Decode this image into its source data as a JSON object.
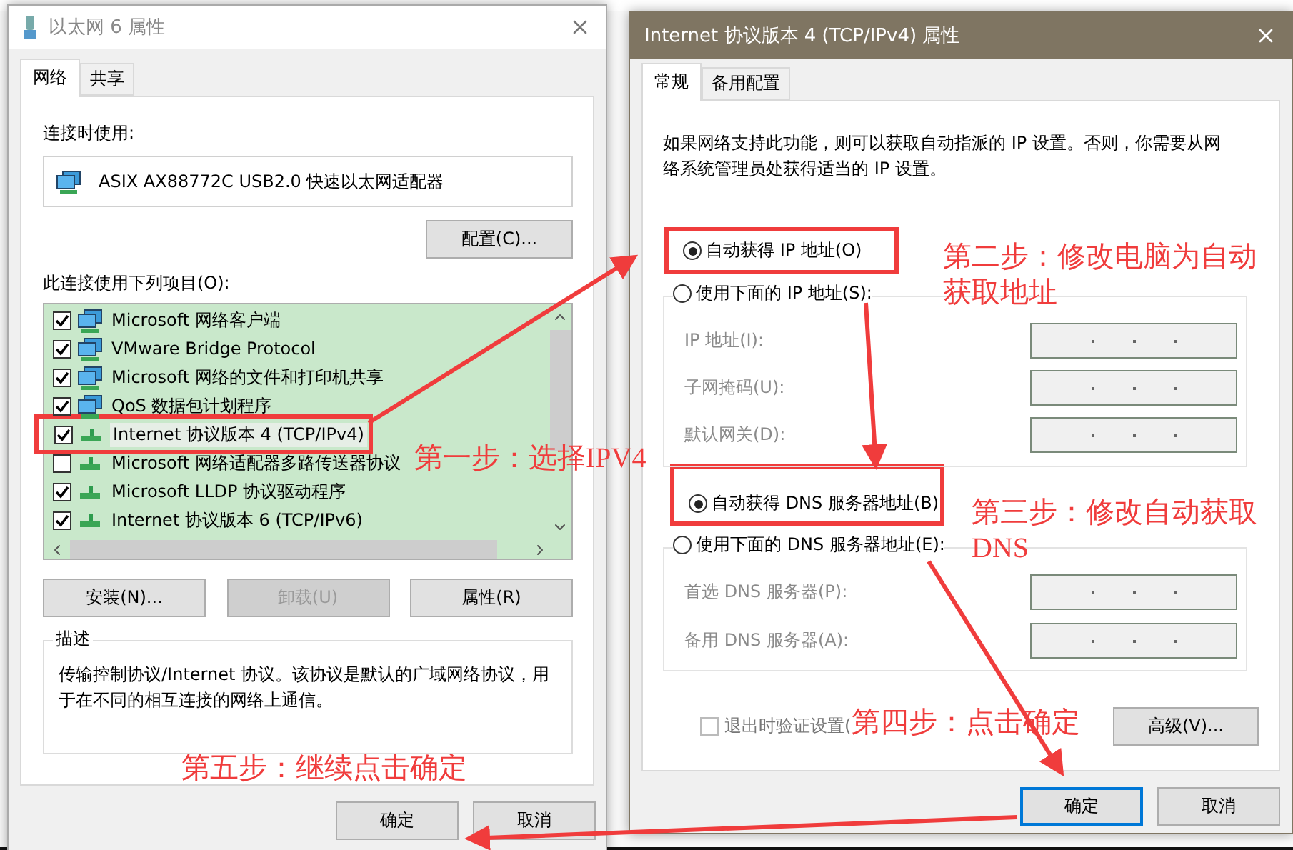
{
  "left_window": {
    "title": "以太网 6 属性",
    "tabs": [
      {
        "label": "网络",
        "selected": true
      },
      {
        "label": "共享",
        "selected": false
      }
    ],
    "connect_using_label": "连接时使用:",
    "adapter": "ASIX AX88772C USB2.0 快速以太网适配器",
    "configure_button": "配置(C)...",
    "items_label": "此连接使用下列项目(O):",
    "items": [
      {
        "label": "Microsoft 网络客户端",
        "checked": true,
        "selected": false,
        "highlighted": false,
        "kind": "client"
      },
      {
        "label": "VMware Bridge Protocol",
        "checked": true,
        "selected": false,
        "highlighted": false,
        "kind": "client"
      },
      {
        "label": "Microsoft 网络的文件和打印机共享",
        "checked": true,
        "selected": false,
        "highlighted": false,
        "kind": "client"
      },
      {
        "label": "QoS 数据包计划程序",
        "checked": true,
        "selected": false,
        "highlighted": false,
        "kind": "client"
      },
      {
        "label": "Internet 协议版本 4 (TCP/IPv4)",
        "checked": true,
        "selected": true,
        "highlighted": true,
        "kind": "protocol"
      },
      {
        "label": "Microsoft 网络适配器多路传送器协议",
        "checked": false,
        "selected": false,
        "highlighted": false,
        "kind": "protocol"
      },
      {
        "label": "Microsoft LLDP 协议驱动程序",
        "checked": true,
        "selected": false,
        "highlighted": false,
        "kind": "protocol"
      },
      {
        "label": "Internet 协议版本 6 (TCP/IPv6)",
        "checked": true,
        "selected": false,
        "highlighted": false,
        "kind": "protocol"
      }
    ],
    "buttons": [
      {
        "label": "安装(N)...",
        "disabled": false
      },
      {
        "label": "卸载(U)",
        "disabled": true
      },
      {
        "label": "属性(R)",
        "disabled": false
      }
    ],
    "description": {
      "title": "描述",
      "text": "传输控制协议/Internet 协议。该协议是默认的广域网络协议，用于在不同的相互连接的网络上通信。"
    },
    "footer_buttons": [
      {
        "label": "确定",
        "focused": false
      },
      {
        "label": "取消",
        "focused": false
      }
    ]
  },
  "right_window": {
    "title": "Internet 协议版本 4 (TCP/IPv4) 属性",
    "tabs": [
      {
        "label": "常规",
        "selected": true
      },
      {
        "label": "备用配置",
        "selected": false
      }
    ],
    "intro": "如果网络支持此功能，则可以获取自动指派的 IP 设置。否则，你需要从网络系统管理员处获得适当的 IP 设置。",
    "ip_options": [
      {
        "label": "自动获得 IP 地址(O)",
        "selected": true,
        "highlighted": true
      },
      {
        "label": "使用下面的 IP 地址(S):",
        "selected": false
      }
    ],
    "ip_fields": [
      {
        "label": "IP 地址(I):",
        "disabled": true
      },
      {
        "label": "子网掩码(U):",
        "disabled": true
      },
      {
        "label": "默认网关(D):",
        "disabled": true
      }
    ],
    "dns_options": [
      {
        "label": "自动获得 DNS 服务器地址(B)",
        "selected": true,
        "highlighted": true
      },
      {
        "label": "使用下面的 DNS 服务器地址(E):",
        "selected": false
      }
    ],
    "dns_fields": [
      {
        "label": "首选 DNS 服务器(P):",
        "disabled": true
      },
      {
        "label": "备用 DNS 服务器(A):",
        "disabled": true
      }
    ],
    "validate_checkbox": {
      "label": "退出时验证设置(",
      "checked": false
    },
    "advanced_button": "高级(V)...",
    "footer_buttons": [
      {
        "label": "确定",
        "focused": true
      },
      {
        "label": "取消",
        "focused": false
      }
    ]
  },
  "annotations": [
    {
      "text": "第一步：选择IPV4"
    },
    {
      "text": "第二步：修改电脑为自动获取地址"
    },
    {
      "text": "第三步：修改自动获取DNS"
    },
    {
      "text": "第四步：点击确定"
    },
    {
      "text": "第五步：继续点击确定"
    }
  ]
}
